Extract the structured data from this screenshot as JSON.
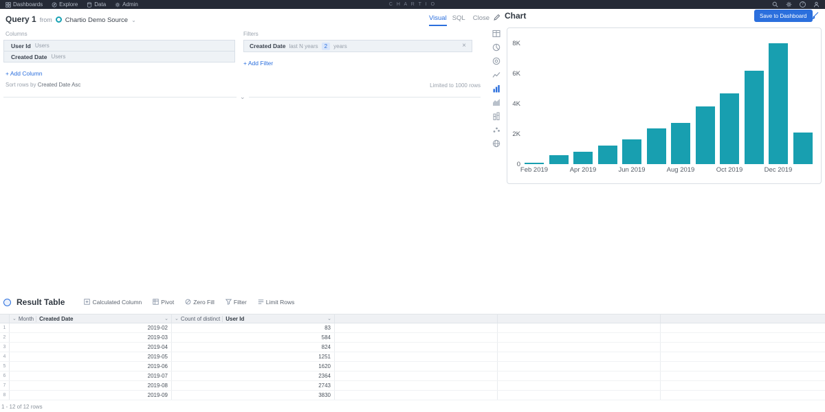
{
  "navbar": {
    "logo": "C H A R T I O",
    "items": [
      {
        "label": "Dashboards",
        "icon": "grid-icon"
      },
      {
        "label": "Explore",
        "icon": "compass-icon"
      },
      {
        "label": "Data",
        "icon": "database-icon"
      },
      {
        "label": "Admin",
        "icon": "gear-icon"
      }
    ],
    "right_icons": [
      "search-icon",
      "settings-icon",
      "help-icon",
      "user-icon"
    ]
  },
  "query": {
    "title": "Query 1",
    "from_label": "from",
    "source": "Chartio Demo Source",
    "columns_label": "Columns",
    "columns": [
      {
        "name": "User Id",
        "table": "Users"
      },
      {
        "name": "Created Date",
        "table": "Users"
      }
    ],
    "add_column_label": "+ Add Column",
    "sort_prefix": "Sort rows by",
    "sort_value": "Created Date Asc"
  },
  "filters": {
    "label": "Filters",
    "items": [
      {
        "name": "Created Date",
        "condition": "last N years",
        "value": "2",
        "unit": "years"
      }
    ],
    "add_filter_label": "+ Add Filter",
    "limit_text": "Limited to 1000 rows"
  },
  "view_tabs": {
    "visual": "Visual",
    "sql": "SQL",
    "close": "Close"
  },
  "chart": {
    "title": "Chart",
    "save_button_label": "Save to Dashboard",
    "accent_color": "#2b6fdd",
    "type_icons": [
      "table-icon",
      "pie-chart-icon",
      "donut-chart-icon",
      "line-chart-icon",
      "bar-chart-icon",
      "area-chart-icon",
      "stacked-bar-icon",
      "scatter-plot-icon",
      "map-icon"
    ],
    "selected_type": "bar-chart-icon"
  },
  "chart_data": {
    "type": "bar",
    "title": "Chart",
    "xlabel": "",
    "ylabel": "",
    "categories": [
      "2019-02",
      "2019-03",
      "2019-04",
      "2019-05",
      "2019-06",
      "2019-07",
      "2019-08",
      "2019-09",
      "2019-10",
      "2019-11",
      "2019-12",
      "2020-01"
    ],
    "values": [
      83,
      584,
      824,
      1251,
      1620,
      2364,
      2743,
      3830,
      4700,
      6200,
      8000,
      2100
    ],
    "x_tick_labels": [
      "Feb 2019",
      "Apr 2019",
      "Jun 2019",
      "Aug 2019",
      "Oct 2019",
      "Dec 2019"
    ],
    "x_tick_every": 2,
    "y_ticks": [
      0,
      2000,
      4000,
      6000,
      8000
    ],
    "y_tick_labels": [
      "0",
      "2K",
      "4K",
      "6K",
      "8K"
    ],
    "ylim": [
      0,
      9000
    ],
    "grid": false,
    "legend": false,
    "bar_color": "#189fb0"
  },
  "result_table": {
    "title": "Result Table",
    "toolbar": [
      {
        "label": "Calculated Column",
        "icon": "calculated-column-icon"
      },
      {
        "label": "Pivot",
        "icon": "pivot-icon"
      },
      {
        "label": "Zero Fill",
        "icon": "zero-fill-icon"
      },
      {
        "label": "Filter",
        "icon": "filter-icon"
      },
      {
        "label": "Limit Rows",
        "icon": "limit-rows-icon"
      }
    ],
    "headers": [
      {
        "agg": "Month",
        "name": "Created Date"
      },
      {
        "agg": "Count of distinct",
        "name": "User Id"
      }
    ],
    "rows": [
      [
        "2019-02",
        "83"
      ],
      [
        "2019-03",
        "584"
      ],
      [
        "2019-04",
        "824"
      ],
      [
        "2019-05",
        "1251"
      ],
      [
        "2019-06",
        "1620"
      ],
      [
        "2019-07",
        "2364"
      ],
      [
        "2019-08",
        "2743"
      ],
      [
        "2019-09",
        "3830"
      ]
    ],
    "footer": "1 - 12 of 12 rows"
  }
}
